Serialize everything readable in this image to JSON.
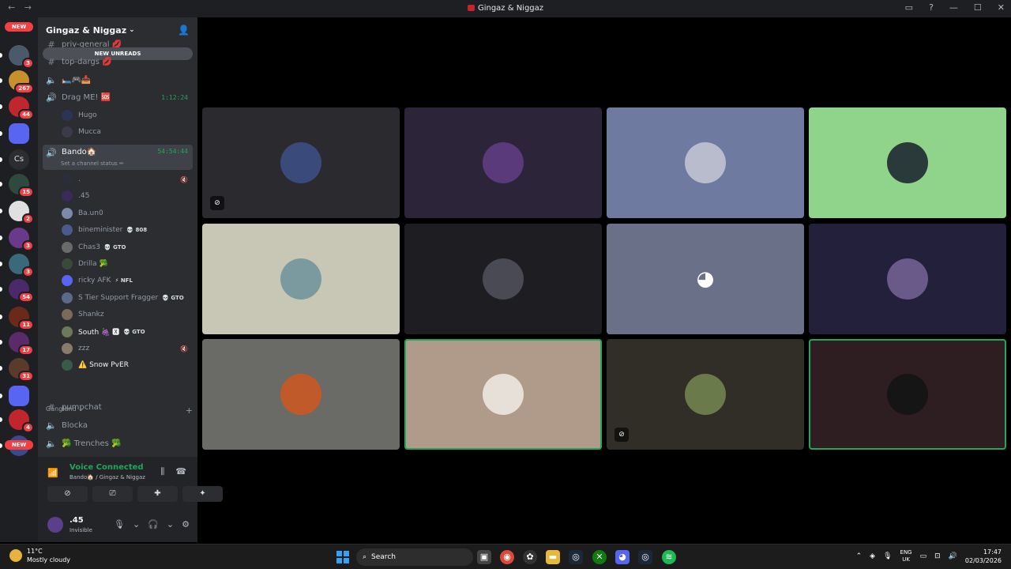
{
  "window": {
    "title": "Gingaz & Niggaz",
    "nav_back": "←",
    "nav_forward": "→",
    "controls": [
      "▭",
      "?",
      "—",
      "☐",
      "✕"
    ]
  },
  "server_rail": {
    "top_pill": "NEW",
    "bottom_pill": "NEW",
    "servers": [
      {
        "badge": "3",
        "color": "#4a5a6a"
      },
      {
        "badge": "267",
        "color": "#c8902a"
      },
      {
        "badge": "44",
        "color": "#c0262d"
      },
      {
        "badge": "",
        "color": "#5865f2"
      },
      {
        "badge": "",
        "color": "#2b2d31",
        "label": "Cs"
      },
      {
        "badge": "15",
        "color": "#2e4a3e"
      },
      {
        "badge": "2",
        "color": "#e0e0e0"
      },
      {
        "badge": "3",
        "color": "#6a3a8a"
      },
      {
        "badge": "3",
        "color": "#3a6a7a"
      },
      {
        "badge": "54",
        "color": "#4a2a6a"
      },
      {
        "badge": "11",
        "color": "#6a2a1a"
      },
      {
        "badge": "17",
        "color": "#5a2a6a"
      },
      {
        "badge": "31",
        "color": "#5a3a2a"
      },
      {
        "badge": "",
        "color": "#5865f2"
      },
      {
        "badge": "4",
        "color": "#c0262d"
      },
      {
        "badge": "",
        "color": "#3a4a8a"
      }
    ]
  },
  "guild": {
    "name": "Gingaz & Niggaz",
    "new_unreads": "NEW UNREADS",
    "channels_top": [
      {
        "name": "priv-general 💋",
        "type": "text"
      },
      {
        "name": "top-dargs 💋",
        "type": "text"
      },
      {
        "name": "🛏️🎮📥",
        "type": "voice"
      }
    ],
    "drag_me": {
      "name": "Drag ME! 🆘",
      "time": "1:12:24",
      "members": [
        "Hugo",
        "Mucca"
      ]
    },
    "bando": {
      "name": "Bando🏠",
      "time": "54:54:44",
      "status": "Set a channel status ✏",
      "members": [
        {
          "name": ".",
          "tag": "",
          "mute": "🔇"
        },
        {
          "name": ".45",
          "tag": ""
        },
        {
          "name": "Ba.un0",
          "tag": ""
        },
        {
          "name": "bineminister",
          "tag": "💀 808"
        },
        {
          "name": "Chas3",
          "tag": "💀 GTO"
        },
        {
          "name": "Drilla 🥦",
          "tag": ""
        },
        {
          "name": "ricky AFK",
          "tag": "⚡ NFL"
        },
        {
          "name": "S Tier Support Fragger",
          "tag": "💀 GTO"
        },
        {
          "name": "Shankz",
          "tag": ""
        },
        {
          "name": "South 🍇 🆇",
          "tag": "💀 GTO"
        },
        {
          "name": "zzz",
          "tag": "",
          "mute": "🔇"
        },
        {
          "name": "⚠️ Snow PvER",
          "tag": ""
        }
      ]
    },
    "category": "Gangland ⌄",
    "channels_bottom": [
      {
        "name": "pumpchat",
        "type": "text"
      },
      {
        "name": "Blocka",
        "type": "voice"
      },
      {
        "name": "🥦 Trenches 🥦",
        "type": "voice"
      }
    ]
  },
  "voice_panel": {
    "status": "Voice Connected",
    "location": "Bando🏠 / Gingaz & Niggaz",
    "buttons": [
      "⊘",
      "⎚",
      "✚",
      "✦"
    ]
  },
  "user": {
    "name": ".45",
    "status": "Invisible"
  },
  "tiles": [
    {
      "bg": "#2b2a2e",
      "av": "#3a4a7a",
      "speaking": false,
      "muted": true
    },
    {
      "bg": "#2c2438",
      "av": "#5a3a7a",
      "speaking": false,
      "muted": false
    },
    {
      "bg": "#6e7aa0",
      "av": "#b8bccc",
      "speaking": false,
      "muted": false
    },
    {
      "bg": "#8fd48a",
      "av": "#2a3a3a",
      "speaking": false,
      "muted": false
    },
    {
      "bg": "#c8c6b4",
      "av": "#7a9aa0",
      "speaking": false,
      "muted": false
    },
    {
      "bg": "#1e1d22",
      "av": "#4a4a55",
      "speaking": false,
      "muted": false
    },
    {
      "bg": "#6a7088",
      "av": "discord",
      "speaking": false,
      "muted": false
    },
    {
      "bg": "#22203a",
      "av": "#6a5a8a",
      "speaking": false,
      "muted": false
    },
    {
      "bg": "#6a6a66",
      "av": "#c05a2a",
      "speaking": false,
      "muted": false
    },
    {
      "bg": "#b09a8a",
      "av": "#e6e0d8",
      "speaking": true,
      "muted": false
    },
    {
      "bg": "#302e26",
      "av": "#6a7a4a",
      "speaking": false,
      "muted": true
    },
    {
      "bg": "#2e1e22",
      "av": "#151515",
      "speaking": true,
      "muted": false
    }
  ],
  "taskbar": {
    "temp": "11°C",
    "condition": "Mostly cloudy",
    "search": "Search",
    "lang_top": "ENG",
    "lang_bottom": "UK",
    "time": "17:47",
    "date": "02/03/2026"
  }
}
